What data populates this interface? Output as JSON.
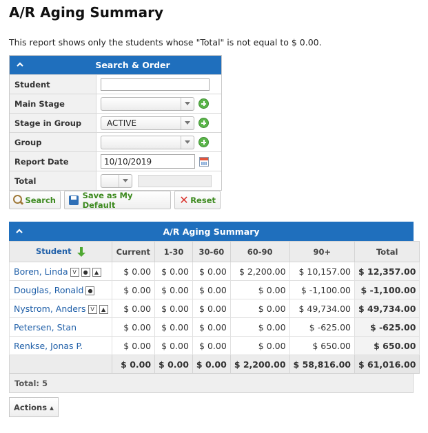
{
  "page": {
    "title": "A/R Aging Summary",
    "note": "This report shows only the students whose \"Total\" is not equal to $ 0.00."
  },
  "search_panel": {
    "title": "Search & Order",
    "fields": {
      "student": {
        "label": "Student",
        "value": ""
      },
      "main_stage": {
        "label": "Main Stage",
        "value": ""
      },
      "stage_in_group": {
        "label": "Stage in Group",
        "value": "ACTIVE"
      },
      "group": {
        "label": "Group",
        "value": ""
      },
      "report_date": {
        "label": "Report Date",
        "value": "10/10/2019"
      },
      "total": {
        "label": "Total",
        "value": ""
      }
    },
    "buttons": {
      "search": "Search",
      "save_default": "Save as My Default",
      "reset": "Reset"
    }
  },
  "summary": {
    "title": "A/R Aging Summary",
    "columns": [
      "Student",
      "Current",
      "1-30",
      "30-60",
      "60-90",
      "90+",
      "Total"
    ],
    "rows": [
      {
        "student": "Boren, Linda",
        "badges": [
          "V",
          "👤",
          "🏠"
        ],
        "current": "$ 0.00",
        "d1_30": "$ 0.00",
        "d30_60": "$ 0.00",
        "d60_90": "$ 2,200.00",
        "d90p": "$ 10,157.00",
        "total": "$ 12,357.00"
      },
      {
        "student": "Douglas, Ronald",
        "badges": [
          "👤"
        ],
        "current": "$ 0.00",
        "d1_30": "$ 0.00",
        "d30_60": "$ 0.00",
        "d60_90": "$ 0.00",
        "d90p": "$ -1,100.00",
        "total": "$ -1,100.00"
      },
      {
        "student": "Nystrom, Anders",
        "badges": [
          "V",
          "🏠"
        ],
        "current": "$ 0.00",
        "d1_30": "$ 0.00",
        "d30_60": "$ 0.00",
        "d60_90": "$ 0.00",
        "d90p": "$ 49,734.00",
        "total": "$ 49,734.00"
      },
      {
        "student": "Petersen, Stan",
        "badges": [],
        "current": "$ 0.00",
        "d1_30": "$ 0.00",
        "d30_60": "$ 0.00",
        "d60_90": "$ 0.00",
        "d90p": "$ -625.00",
        "total": "$ -625.00"
      },
      {
        "student": "Renkse, Jonas P.",
        "badges": [],
        "current": "$ 0.00",
        "d1_30": "$ 0.00",
        "d30_60": "$ 0.00",
        "d60_90": "$ 0.00",
        "d90p": "$ 650.00",
        "total": "$ 650.00"
      }
    ],
    "totals": {
      "current": "$ 0.00",
      "d1_30": "$ 0.00",
      "d30_60": "$ 0.00",
      "d60_90": "$ 2,200.00",
      "d90p": "$ 58,816.00",
      "total": "$ 61,016.00"
    },
    "footer": "Total: 5"
  },
  "actions_label": "Actions ▴",
  "colors": {
    "header_blue": "#1f6fbd",
    "link_blue": "#1f5fa8",
    "button_green": "#3d8a1f"
  }
}
